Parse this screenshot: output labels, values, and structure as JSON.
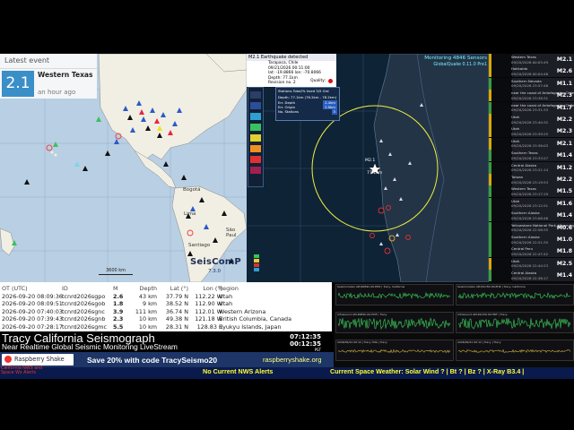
{
  "latest_event": {
    "header": "Latest event",
    "magnitude": "2.1",
    "region": "Western Texas",
    "time_ago": "an hour ago"
  },
  "world_map": {
    "labels": [
      "Bogotá",
      "Lima",
      "São Paul",
      "Santiago"
    ],
    "scale": "3600 km",
    "brand": "SeisComP",
    "version": "7.3.0"
  },
  "eq_panel": {
    "title": "M2.1 Earthquake detected",
    "lines": [
      "Tarapaca, Chile",
      "09/21/2026 00:11:00",
      "lat: -19.8866 lon: -70.8066",
      "Depth: 77.1km",
      "Revision no. 2"
    ],
    "quality_label": "Quality:"
  },
  "stations": {
    "title": "Stations Total/% Used 5/5 Grd",
    "subtitle": "Depth: 77.1km (76.2km - 78.2km)",
    "rows": [
      {
        "label": "Err. Depth",
        "value": "2.4km"
      },
      {
        "label": "Err. Origin",
        "value": "2.9km"
      },
      {
        "label": "No. Stations",
        "value": "5"
      }
    ]
  },
  "chile_map": {
    "monitor_label": "Monitoring 4846 Sensors",
    "sensor_note": "GlobalQuake 0.11.0 Pre1",
    "epicenter_mag": "M2.1",
    "epicenter_depth": "77.1km"
  },
  "events": [
    {
      "region": "Western Texas",
      "time": "09/20/2026 00:05:49",
      "mag": "M2.1",
      "color": "#d9a700"
    },
    {
      "region": "Hokkaido",
      "time": "09/20/2026 00:04:48",
      "mag": "M2.6",
      "color": "#d9a700"
    },
    {
      "region": "Southern Nevada",
      "time": "09/20/2026 23:57:48",
      "mag": "M1.1",
      "color": "#3a9e3a"
    },
    {
      "region": "near the coast of Antofagasta, Chile",
      "time": "09/20/2026 23:38:31",
      "mag": "M2.3",
      "color": "#d9a700"
    },
    {
      "region": "near the coast of Antofagasta, Chile",
      "time": "09/20/2026 23:31:33",
      "mag": "M1.7",
      "color": "#3a9e3a"
    },
    {
      "region": "Utah",
      "time": "09/20/2026 23:40:32",
      "mag": "M2.2",
      "color": "#d9a700"
    },
    {
      "region": "Utah",
      "time": "09/20/2026 23:39:25",
      "mag": "M2.3",
      "color": "#d9a700"
    },
    {
      "region": "Utah",
      "time": "09/20/2026 23:36:03",
      "mag": "M2.1",
      "color": "#d9a700"
    },
    {
      "region": "Southern Texas",
      "time": "09/20/2026 23:33:27",
      "mag": "M1.4",
      "color": "#3a9e3a"
    },
    {
      "region": "Central Alaska",
      "time": "09/20/2026 23:21:14",
      "mag": "M1.2",
      "color": "#3a9e3a"
    },
    {
      "region": "Taiwan",
      "time": "09/20/2026 23:19:53",
      "mag": "M2.2",
      "color": "#d9a700"
    },
    {
      "region": "Western Texas",
      "time": "09/20/2026 23:17:19",
      "mag": "M1.5",
      "color": "#3a9e3a"
    },
    {
      "region": "Utah",
      "time": "09/20/2026 23:12:51",
      "mag": "M1.6",
      "color": "#3a9e3a"
    },
    {
      "region": "Southern Alaska",
      "time": "09/20/2026 23:08:46",
      "mag": "M1.4",
      "color": "#3a9e3a"
    },
    {
      "region": "Yellowstone National Park, Wyoming",
      "time": "09/20/2026 22:58:35",
      "mag": "M0.6",
      "color": "#3a9e3a"
    },
    {
      "region": "Southern Alaska",
      "time": "09/20/2026 22:51:35",
      "mag": "M1.0",
      "color": "#3a9e3a"
    },
    {
      "region": "Central Peru",
      "time": "09/20/2026 22:47:42",
      "mag": "M1.8",
      "color": "#3a9e3a"
    },
    {
      "region": "Utah",
      "time": "09/20/2026 22:44:23",
      "mag": "M2.5",
      "color": "#d9a700"
    },
    {
      "region": "Central Alaska",
      "time": "09/20/2026 22:38:17",
      "mag": "M1.4",
      "color": "#3a9e3a"
    }
  ],
  "events_table": {
    "headers": [
      "OT (UTC)",
      "ID",
      "M",
      "Depth",
      "Lat (°)",
      "Lon (°)",
      "Region"
    ],
    "rows": [
      [
        "2026-09-20 08:09:36",
        "tcnrd2026sgpo",
        "2.6",
        "43 km",
        "37.79 N",
        "112.22 W",
        "Utah"
      ],
      [
        "2026-09-20 08:09:51",
        "tcnrd2026sgob",
        "1.8",
        "9 km",
        "38.52 N",
        "112.90 W",
        "Utah"
      ],
      [
        "2026-09-20 07:40:03",
        "tcnrd2026sgnc",
        "3.9",
        "111 km",
        "36.74 N",
        "112.01 W",
        "Western Arizona"
      ],
      [
        "2026-09-20 07:39:43",
        "tcnrd2026sgnb",
        "2.3",
        "10 km",
        "49.38 N",
        "121.18 W",
        "British Columbia, Canada"
      ],
      [
        "2026-09-20 07:28:17",
        "tcnrd2026sgmc",
        "5.5",
        "10 km",
        "28.31 N",
        "128.83 E",
        "Ryukyu Islands, Japan"
      ]
    ]
  },
  "seismograms": [
    {
      "label": "Seismometer AM.R0E9C.00.EHZ | Tracy, California"
    },
    {
      "label": "Seismometer AM.R1C5D.00.EHZ | Tracy, California"
    },
    {
      "label": "Infrasound AM.R0E9C.00.HDF | Tracy"
    },
    {
      "label": "Infrasound AM.R1C5D.00.HDF | Tracy"
    },
    {
      "label": "2026/09/21 00:12 | Tracy Hills | Tracy"
    },
    {
      "label": "2026/09/21 00:12 | Tracy | Tracy"
    }
  ],
  "banner": {
    "title": "Tracy California Seismograph",
    "subtitle": "Near Realtime Global Seismic Monitoring LiveStream",
    "time_local": "07:12:35",
    "time_utc": "00:12:35",
    "tz": "PST",
    "promo": "Save 20% with code TracySeismo20",
    "site": "raspberryshake.org",
    "logo": "Raspberry Shake"
  },
  "ticker": {
    "left": "California NWS and Space Wx Alerts",
    "nws": "No Current NWS Alerts",
    "space_weather": "Current Space Weather: Solar Wind ? | Bt ? | Bz ? | X-Ray B3.4 |"
  }
}
